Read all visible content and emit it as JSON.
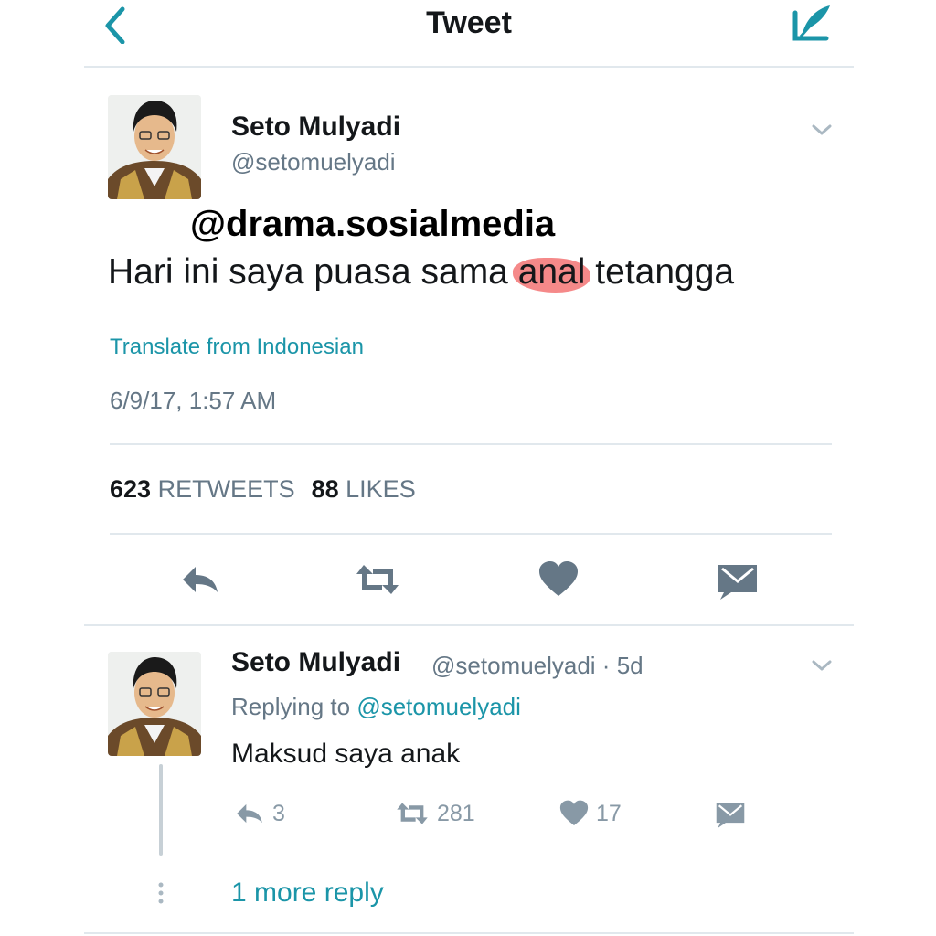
{
  "header": {
    "title": "Tweet",
    "back_icon": "chevron-left-icon",
    "compose_icon": "compose-icon"
  },
  "main_tweet": {
    "name": "Seto Mulyadi",
    "handle": "@setomuelyadi",
    "watermark": "@drama.sosialmedia",
    "text_before": "Hari ini saya puasa sama ",
    "text_highlight": "anal",
    "text_after": " tetangga",
    "translate_label": "Translate from Indonesian",
    "timestamp": "6/9/17, 1:57 AM",
    "retweets_count": "623",
    "retweets_label": "RETWEETS",
    "likes_count": "88",
    "likes_label": "LIKES",
    "actions": [
      "reply-icon",
      "retweet-icon",
      "heart-icon",
      "message-icon"
    ]
  },
  "reply_tweet": {
    "name": "Seto Mulyadi",
    "handle_time": "@setomuelyadi · 5d",
    "replying_prefix": "Replying to ",
    "replying_handle": "@setomuelyadi",
    "text": "Maksud saya anak",
    "reply_count": "3",
    "retweet_count": "281",
    "like_count": "17",
    "more_replies": "1 more reply"
  },
  "colors": {
    "accent": "#1b95a8",
    "text": "#14171a",
    "muted": "#657786",
    "icon": "#657786",
    "highlight": "#ec2828"
  }
}
